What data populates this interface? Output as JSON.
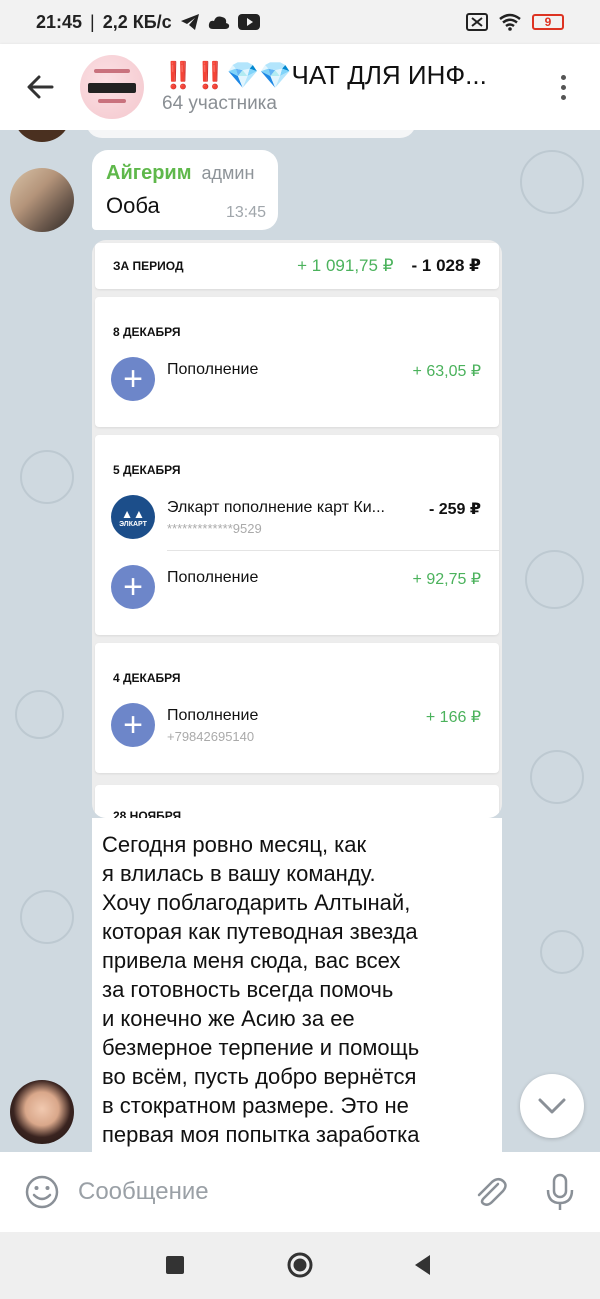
{
  "status_bar": {
    "time": "21:45",
    "speed": "2,2 КБ/с",
    "battery": "9"
  },
  "header": {
    "title_marks": "‼️‼️",
    "title_gems": "💎💎",
    "title_text": "ЧАТ ДЛЯ ИНФ...",
    "subtitle": "64 участника"
  },
  "message1": {
    "sender": "Айгерим",
    "role": "админ",
    "text": "Ооба",
    "time": "13:45"
  },
  "statement": {
    "period_label": "ЗА ПЕРИОД",
    "period_income": "+ 1 091,75 ₽",
    "period_expense": "- 1 028 ₽",
    "groups": [
      {
        "date": "8 ДЕКАБРЯ",
        "items": [
          {
            "title": "Пополнение",
            "sub": "",
            "amount": "+ 63,05 ₽"
          }
        ]
      },
      {
        "date": "5 ДЕКАБРЯ",
        "items": [
          {
            "title": "Элкарт пополнение карт Ки...",
            "sub": "*************9529",
            "amount": "- 259 ₽"
          },
          {
            "title": "Пополнение",
            "sub": "",
            "amount": "+ 92,75 ₽"
          }
        ]
      },
      {
        "date": "4 ДЕКАБРЯ",
        "items": [
          {
            "title": "Пополнение",
            "sub": "+79842695140",
            "amount": "+ 166 ₽"
          }
        ]
      }
    ],
    "cut_date": "28 НОЯБРЯ",
    "elcart_logo": "ЭЛКАРТ"
  },
  "message2": {
    "text": "Сегодня ровно месяц, как\nя влилась в вашу команду.\nХочу поблагодарить Алтынай,\nкоторая как путеводная звезда\nпривела меня сюда, вас всех\nза готовность всегда помочь\nи конечно же Асию за ее\nбезмерное терпение и помощь\nво всём, пусть добро вернётся\nв стократном размере. Это не\nпервая моя попытка заработка"
  },
  "input": {
    "placeholder": "Сообщение"
  },
  "icons": [
    "back-arrow-icon",
    "more-vert-icon",
    "emoji-icon",
    "attach-icon",
    "mic-icon",
    "chevron-down-icon"
  ],
  "colors": {
    "accent_green": "#5fb84b",
    "chat_bg": "#cfd9e0",
    "income_green": "#4bb25c"
  }
}
